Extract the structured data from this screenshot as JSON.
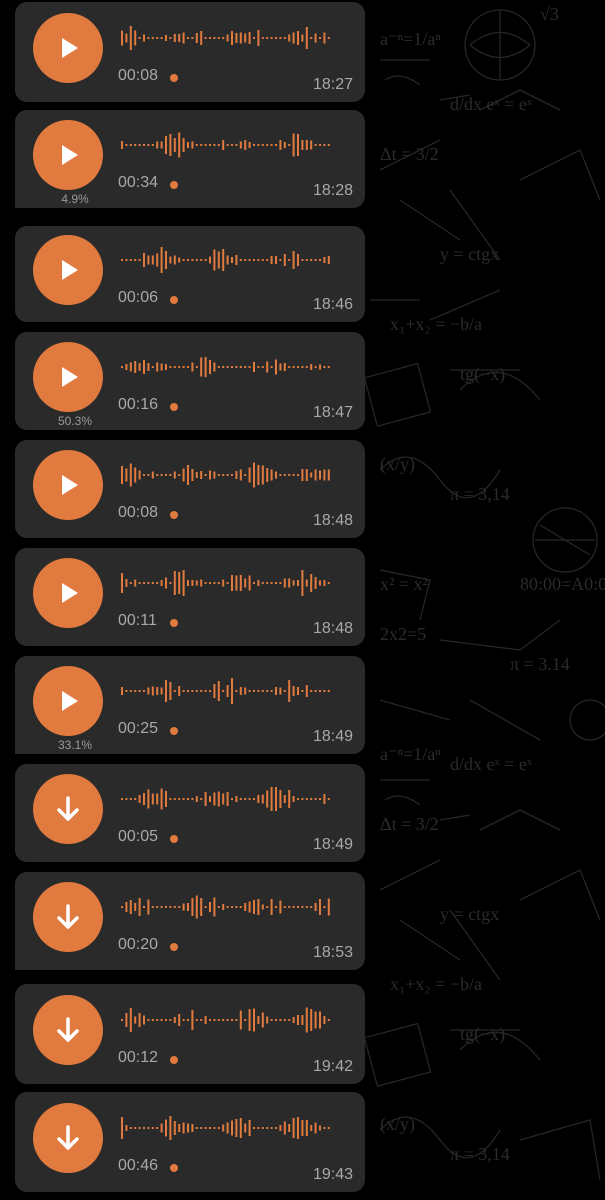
{
  "theme": {
    "accent": "#e07a3f",
    "bubble": "#2a2a2a",
    "background": "#000000",
    "text_muted": "#a8a8a8"
  },
  "messages": [
    {
      "icon": "play-icon",
      "duration": "00:08",
      "time": "18:27",
      "progress_label": "",
      "unread_dot": true
    },
    {
      "icon": "play-icon",
      "duration": "00:34",
      "time": "18:28",
      "progress_label": "4.9%",
      "unread_dot": true
    },
    {
      "icon": "play-icon",
      "duration": "00:06",
      "time": "18:46",
      "progress_label": "",
      "unread_dot": true
    },
    {
      "icon": "play-icon",
      "duration": "00:16",
      "time": "18:47",
      "progress_label": "50.3%",
      "unread_dot": true
    },
    {
      "icon": "play-icon",
      "duration": "00:08",
      "time": "18:48",
      "progress_label": "",
      "unread_dot": true
    },
    {
      "icon": "play-icon",
      "duration": "00:11",
      "time": "18:48",
      "progress_label": "",
      "unread_dot": true
    },
    {
      "icon": "play-icon",
      "duration": "00:25",
      "time": "18:49",
      "progress_label": "33.1%",
      "unread_dot": true
    },
    {
      "icon": "download-icon",
      "duration": "00:05",
      "time": "18:49",
      "progress_label": "",
      "unread_dot": true
    },
    {
      "icon": "download-icon",
      "duration": "00:20",
      "time": "18:53",
      "progress_label": "",
      "unread_dot": true
    },
    {
      "icon": "download-icon",
      "duration": "00:12",
      "time": "19:42",
      "progress_label": "",
      "unread_dot": true
    },
    {
      "icon": "download-icon",
      "duration": "00:46",
      "time": "19:43",
      "progress_label": "",
      "unread_dot": true
    }
  ]
}
